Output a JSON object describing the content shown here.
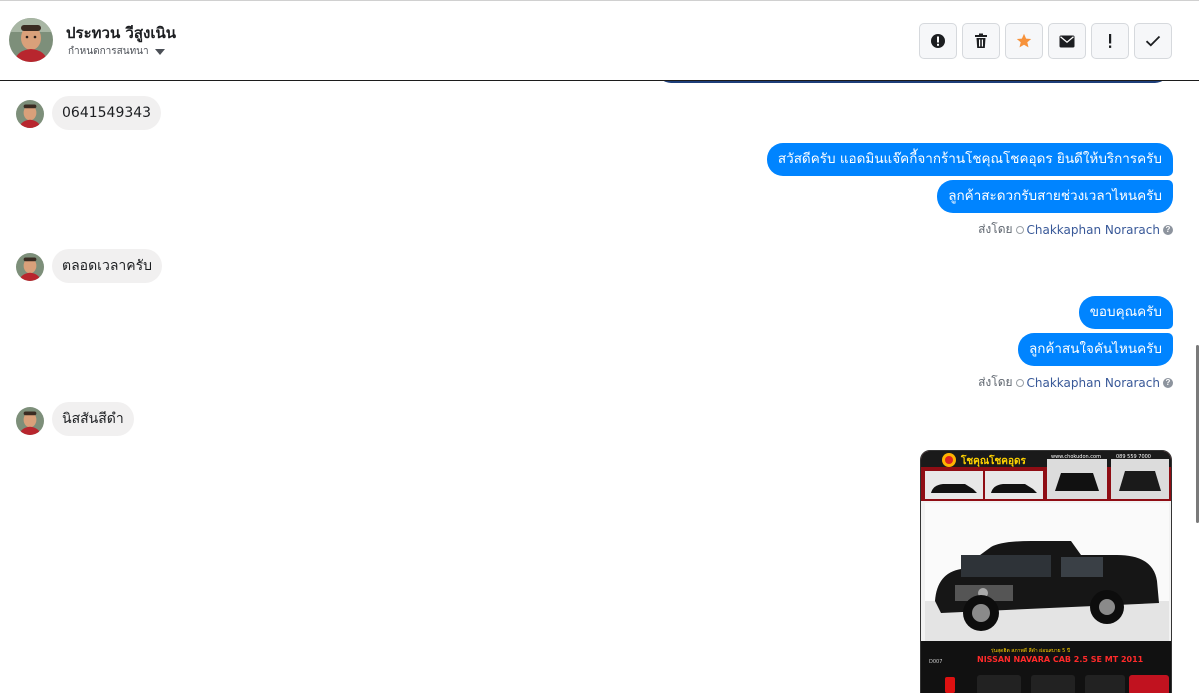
{
  "header": {
    "contact_name": "ประทวน วีสูงเนิน",
    "subtitle": "กำหนดการสนทนา",
    "tools": [
      {
        "name": "report-icon",
        "label": "!"
      },
      {
        "name": "trash-icon",
        "label": ""
      },
      {
        "name": "star-icon",
        "label": ""
      },
      {
        "name": "mail-icon",
        "label": ""
      },
      {
        "name": "important-icon",
        "label": "!"
      },
      {
        "name": "checkmark-icon",
        "label": ""
      }
    ]
  },
  "messages": {
    "in_1": "0641549343",
    "out_1a": "สวัสดีครับ แอดมินแจ๊คกี้จากร้านโชคุณโชคอุดร ยินดีให้บริการครับ",
    "out_1b": "ลูกค้าสะดวกรับสายช่วงเวลาไหนครับ",
    "in_2": "ตลอดเวลาครับ",
    "out_2a": "ขอบคุณครับ",
    "out_2b": "ลูกค้าสนใจคันไหนครับ",
    "in_3": "นิสสันสีดำ"
  },
  "sent_by": {
    "prefix": "ส่งโดย",
    "agent": "Chakkaphan Norarach",
    "help": "?"
  },
  "car_card": {
    "shop_name": "โชคุณโชคอุดร",
    "site": "www.chokudon.com",
    "phone": "089 559 7000",
    "code": "D007",
    "caption": "รุ่นสุดฮิต สภาพดี สีดำ ผ่อนสบาย 5 ปี",
    "model": "NISSAN NAVARA CAB 2.5 SE MT 2011"
  },
  "colors": {
    "accent_blue": "#0084ff",
    "incoming_bg": "#f1f0f0",
    "star_orange": "#f7923b",
    "banner_red": "#c1121f"
  }
}
